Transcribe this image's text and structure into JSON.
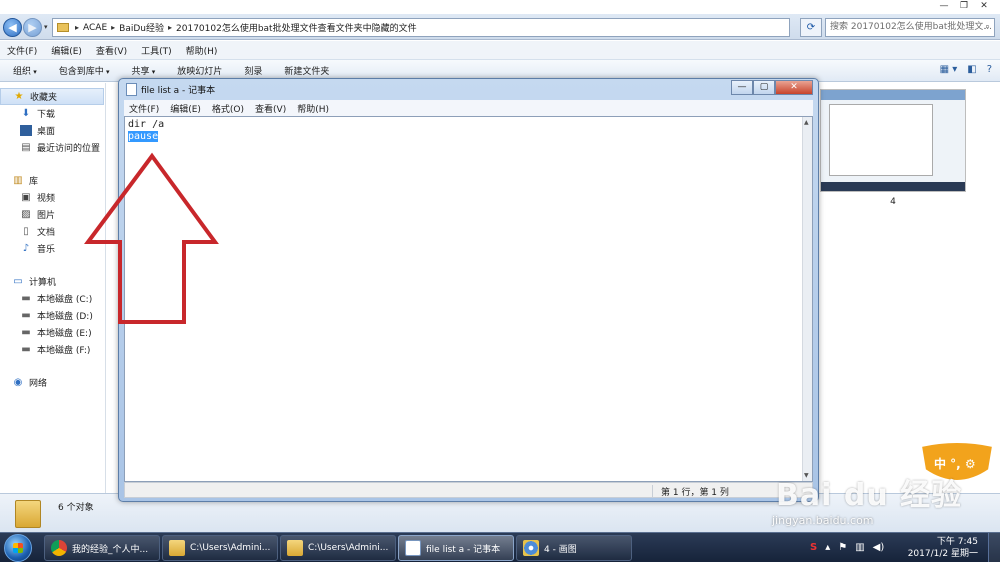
{
  "explorer": {
    "breadcrumbs": [
      "ACAE",
      "BaiDu经验",
      "20170102怎么使用bat批处理文件查看文件夹中隐藏的文件"
    ],
    "search_placeholder": "搜索 20170102怎么使用bat批处理文...",
    "menu": [
      "文件(F)",
      "编辑(E)",
      "查看(V)",
      "工具(T)",
      "帮助(H)"
    ],
    "toolbar": [
      "组织",
      "包含到库中",
      "共享",
      "放映幻灯片",
      "刻录",
      "新建文件夹"
    ],
    "nav": {
      "favorites": "收藏夹",
      "favorites_items": [
        "下载",
        "桌面",
        "最近访问的位置"
      ],
      "libraries": "库",
      "library_items": [
        "视频",
        "图片",
        "文档",
        "音乐"
      ],
      "computer": "计算机",
      "drives": [
        "本地磁盘 (C:)",
        "本地磁盘 (D:)",
        "本地磁盘 (E:)",
        "本地磁盘 (F:)"
      ],
      "network": "网络"
    },
    "file": {
      "label": "4"
    },
    "status": {
      "count": "6 个对象"
    }
  },
  "notepad": {
    "title": "file list a - 记事本",
    "menu": [
      "文件(F)",
      "编辑(E)",
      "格式(O)",
      "查看(V)",
      "帮助(H)"
    ],
    "lines": [
      "dir /a",
      "pause"
    ],
    "status_pos": "第 1 行，第 1 列"
  },
  "taskbar": {
    "tasks": [
      "我的经验_个人中...",
      "C:\\Users\\Admini...",
      "C:\\Users\\Admini...",
      "file list a - 记事本",
      "4 - 画图"
    ],
    "active_task_index": 3,
    "time": "下午 7:45",
    "date": "2017/1/2 星期一",
    "ime_label": "中 °, ⚙"
  },
  "watermark": {
    "main": "Bai du 经验",
    "sub": "jingyan.baidu.com"
  },
  "colors": {
    "selection": "#3399ff",
    "arrow": "#c8272b",
    "ime_badge": "#f2a31c"
  }
}
